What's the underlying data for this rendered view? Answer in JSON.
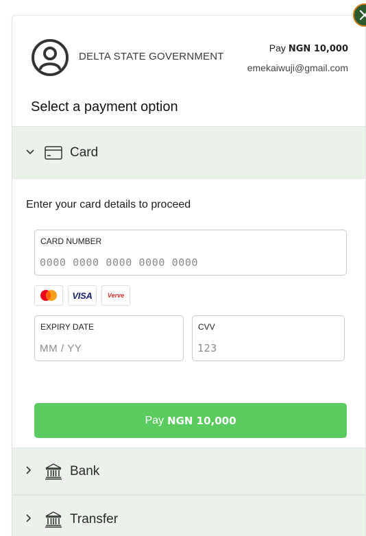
{
  "header": {
    "merchant_name": "DELTA STATE GOVERNMENT",
    "pay_label": "Pay",
    "pay_amount": "NGN 10,000",
    "email": "emekaiwuji@gmail.com",
    "avatar_icon": "user-circle-icon",
    "close_icon": "close-icon"
  },
  "section_title": "Select a payment option",
  "options": [
    {
      "label": "Card",
      "icon": "credit-card-icon",
      "expanded": true,
      "chevron": "chevron-down-icon"
    },
    {
      "label": "Bank",
      "icon": "bank-building-icon",
      "expanded": false,
      "chevron": "chevron-right-icon"
    },
    {
      "label": "Transfer",
      "icon": "bank-building-icon",
      "expanded": false,
      "chevron": "chevron-right-icon"
    }
  ],
  "card_form": {
    "prompt": "Enter your card details to proceed",
    "card_number": {
      "label": "CARD NUMBER",
      "placeholder": "0000 0000 0000 0000 0000",
      "value": ""
    },
    "brands": [
      "Mastercard",
      "VISA",
      "Verve"
    ],
    "expiry": {
      "label": "EXPIRY DATE",
      "placeholder": "MM / YY",
      "value": ""
    },
    "cvv": {
      "label": "CVV",
      "placeholder": "123",
      "value": ""
    },
    "pay_button": {
      "label": "Pay",
      "amount": "NGN 10,000"
    }
  },
  "colors": {
    "accent_green": "#5acb5f",
    "option_header_bg": "#eaf2ea",
    "close_button_bg": "#2c5a2e",
    "close_button_ring": "#c77a18"
  }
}
